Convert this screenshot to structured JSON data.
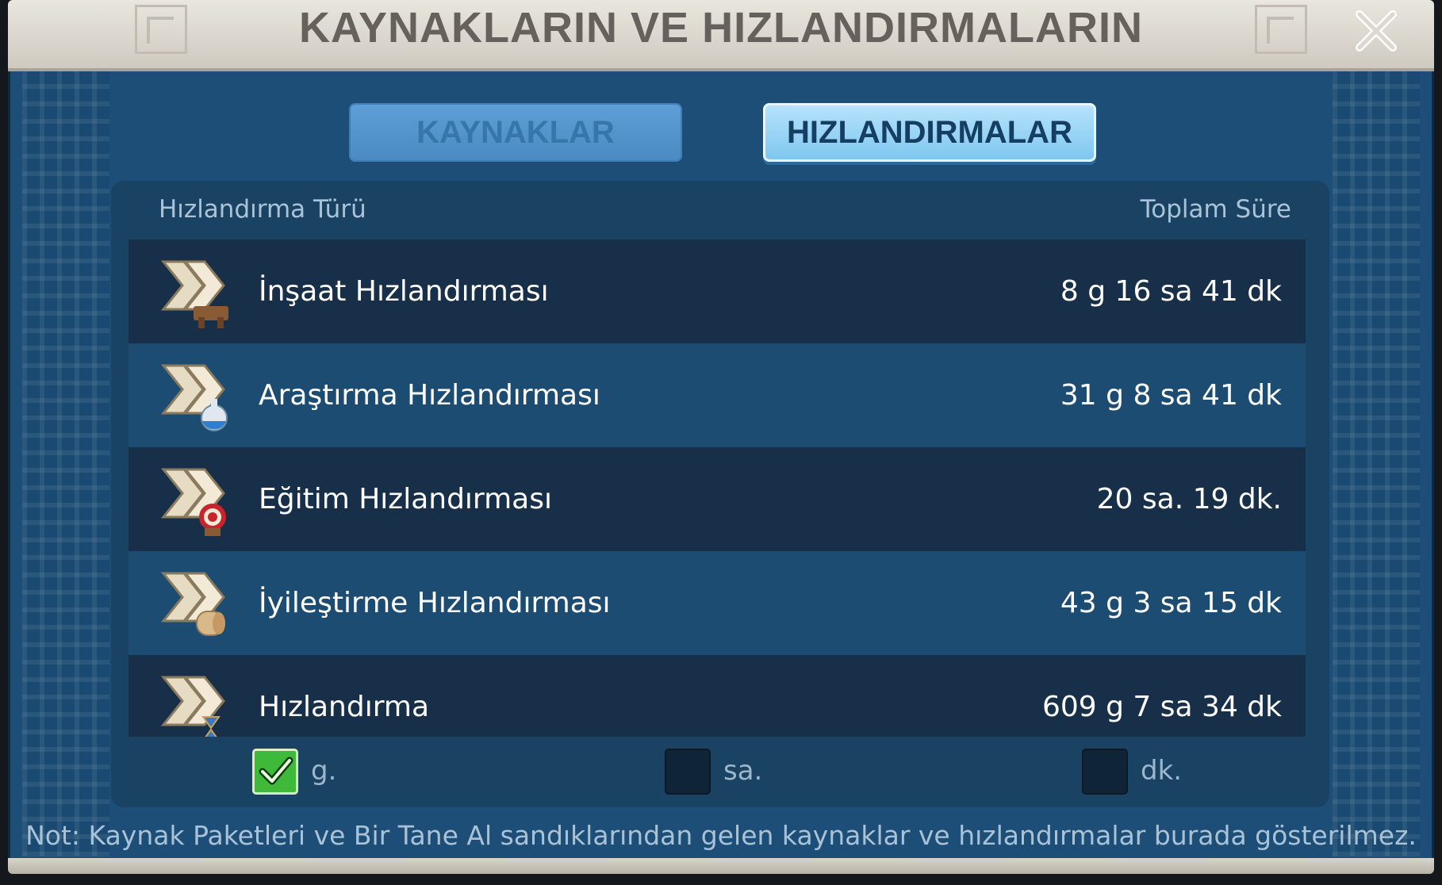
{
  "dialog": {
    "title": "KAYNAKLARIN VE HIZLANDIRMALARIN",
    "close_icon": "close-icon"
  },
  "tabs": [
    {
      "label": "KAYNAKLAR",
      "active": false
    },
    {
      "label": "HIZLANDIRMALAR",
      "active": true
    }
  ],
  "table": {
    "col_type": "Hızlandırma Türü",
    "col_total": "Toplam Süre",
    "rows": [
      {
        "icon": "construction-speedup-icon",
        "label": "İnşaat Hızlandırması",
        "value": "8 g 16 sa 41 dk"
      },
      {
        "icon": "research-speedup-icon",
        "label": "Araştırma Hızlandırması",
        "value": "31 g 8 sa 41 dk"
      },
      {
        "icon": "training-speedup-icon",
        "label": "Eğitim Hızlandırması",
        "value": "20 sa. 19 dk."
      },
      {
        "icon": "healing-speedup-icon",
        "label": "İyileştirme Hızlandırması",
        "value": "43 g 3 sa 15 dk"
      },
      {
        "icon": "universal-speedup-icon",
        "label": "Hızlandırma",
        "value": "609 g 7 sa 34 dk"
      }
    ]
  },
  "filters": [
    {
      "label": "g.",
      "checked": true
    },
    {
      "label": "sa.",
      "checked": false
    },
    {
      "label": "dk.",
      "checked": false
    }
  ],
  "note": "Not: Kaynak Paketleri ve Bir Tane Al sandıklarından gelen kaynaklar ve hızlandırmalar burada gösterilmez.",
  "colors": {
    "panel": "#1d4e78",
    "active_tab": "#7cc6f0",
    "checkbox_on": "#3fb93a"
  }
}
